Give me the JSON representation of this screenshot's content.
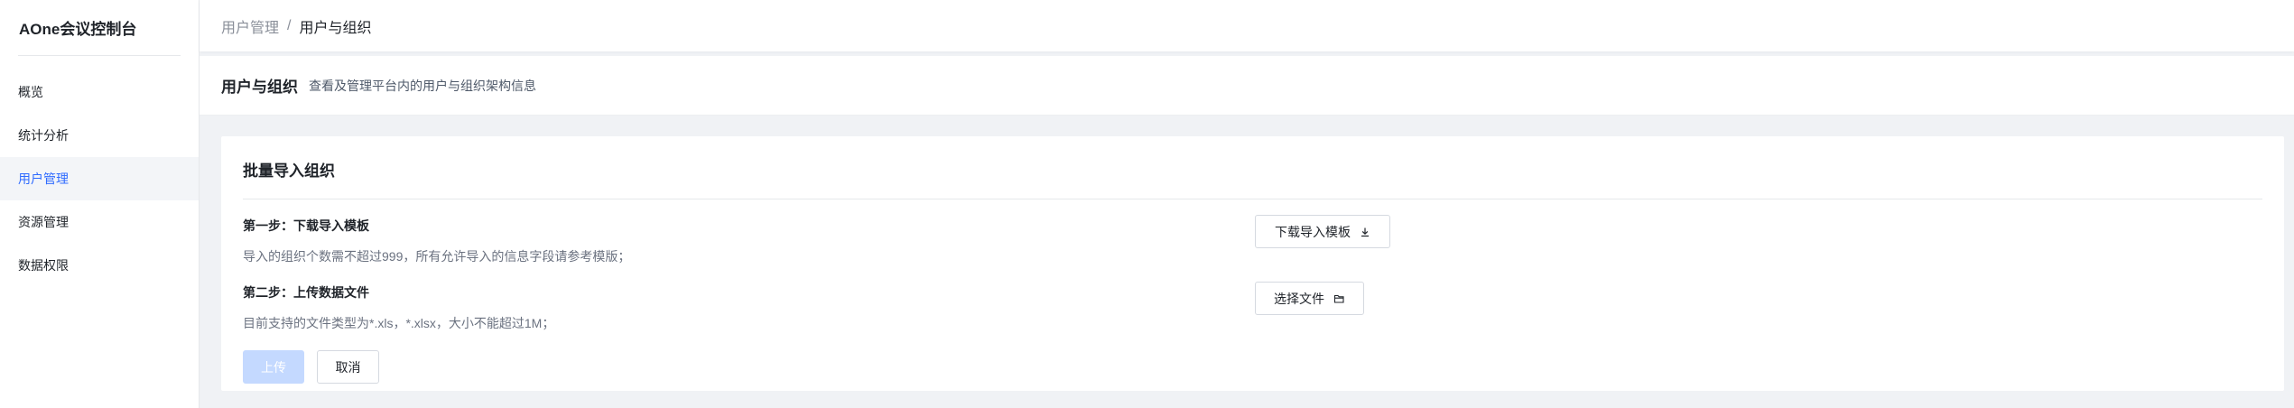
{
  "app": {
    "title": "AOne会议控制台"
  },
  "sidebar": {
    "items": [
      {
        "label": "概览",
        "active": false
      },
      {
        "label": "统计分析",
        "active": false
      },
      {
        "label": "用户管理",
        "active": true
      },
      {
        "label": "资源管理",
        "active": false
      },
      {
        "label": "数据权限",
        "active": false
      }
    ]
  },
  "breadcrumb": {
    "parent": "用户管理",
    "separator": "/",
    "current": "用户与组织"
  },
  "page_header": {
    "title": "用户与组织",
    "description": "查看及管理平台内的用户与组织架构信息"
  },
  "card": {
    "title": "批量导入组织",
    "step1": {
      "title": "第一步：下载导入模板",
      "description": "导入的组织个数需不超过999，所有允许导入的信息字段请参考模版；",
      "button_label": "下载导入模板",
      "button_icon": "download-icon"
    },
    "step2": {
      "title": "第二步：上传数据文件",
      "description": "目前支持的文件类型为*.xls，*.xlsx，大小不能超过1M；",
      "button_label": "选择文件",
      "button_icon": "folder-icon"
    },
    "upload_label": "上传",
    "cancel_label": "取消"
  },
  "colors": {
    "accent": "#2f6bff",
    "primary_disabled": "#c4d9ff",
    "sidebar_active_bg": "#f3f5f8",
    "page_bg": "#f0f2f5"
  }
}
